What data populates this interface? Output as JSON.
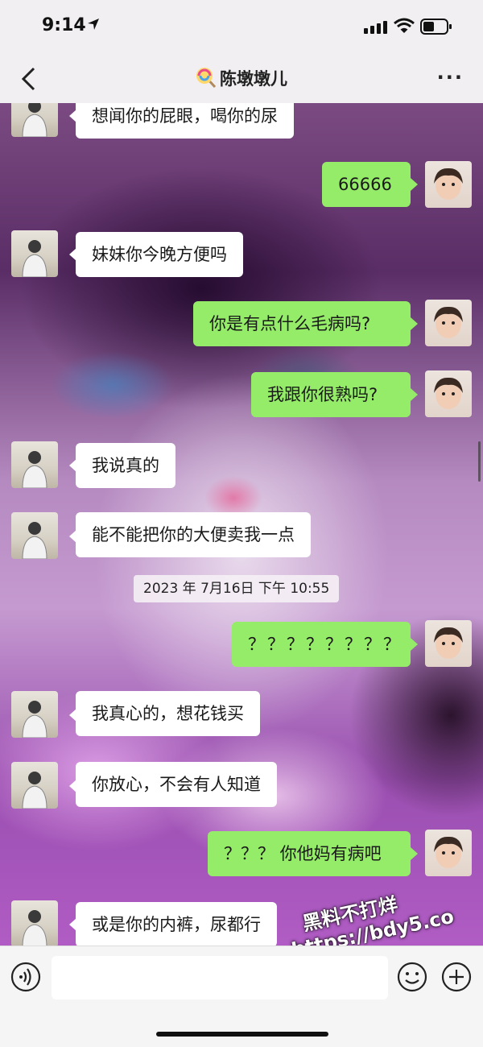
{
  "status": {
    "time": "9:14"
  },
  "header": {
    "title": "陈墩墩儿"
  },
  "messages": [
    {
      "side": "in",
      "text": "想闻你的屁眼，喝你的尿"
    },
    {
      "side": "out",
      "text": "66666"
    },
    {
      "side": "in",
      "text": "妹妹你今晚方便吗"
    },
    {
      "side": "out",
      "text": "你是有点什么毛病吗?"
    },
    {
      "side": "out",
      "text": "我跟你很熟吗?"
    },
    {
      "side": "in",
      "text": "我说真的"
    },
    {
      "side": "in",
      "text": "能不能把你的大便卖我一点"
    },
    {
      "side": "out",
      "text": "？？？？？？？？"
    },
    {
      "side": "in",
      "text": "我真心的，想花钱买"
    },
    {
      "side": "in",
      "text": "你放心，不会有人知道"
    },
    {
      "side": "out",
      "text": "？？？ 你他妈有病吧"
    },
    {
      "side": "in",
      "text": "或是你的内裤，尿都行"
    }
  ],
  "timestamp": "2023 年 7月16日 下午 10:55",
  "watermark": {
    "line1": "黑料不打烊",
    "line2": "https://bdy5.co"
  },
  "colors": {
    "outgoing_bubble": "#95ec69",
    "incoming_bubble": "#ffffff"
  }
}
